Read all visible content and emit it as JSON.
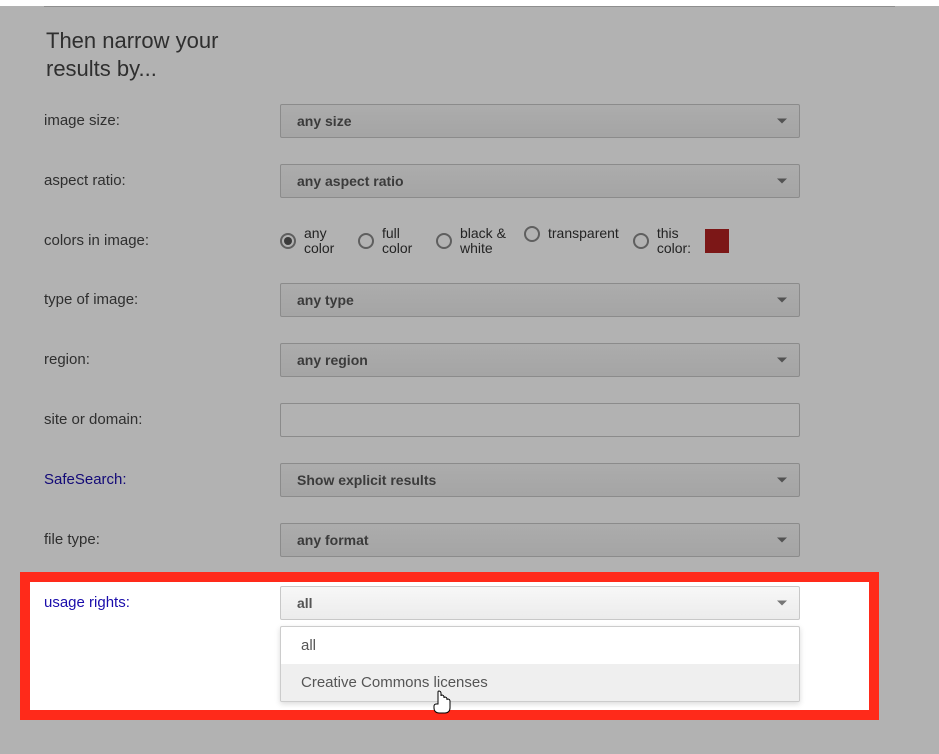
{
  "heading": "Then narrow your results by...",
  "rows": {
    "image_size": {
      "label": "image size:",
      "value": "any size"
    },
    "aspect_ratio": {
      "label": "aspect ratio:",
      "value": "any aspect ratio"
    },
    "colors": {
      "label": "colors in image:",
      "options": {
        "any": "any color",
        "full": "full color",
        "bw": "black & white",
        "transparent": "transparent",
        "this": "this color:"
      },
      "selected": "any",
      "swatch_color": "#b22222"
    },
    "type_of_image": {
      "label": "type of image:",
      "value": "any type"
    },
    "region": {
      "label": "region:",
      "value": "any region"
    },
    "site_or_domain": {
      "label": "site or domain:",
      "value": ""
    },
    "safesearch": {
      "label": "SafeSearch:",
      "value": "Show explicit results"
    },
    "file_type": {
      "label": "file type:",
      "value": "any format"
    },
    "usage_rights": {
      "label": "usage rights:",
      "value": "all",
      "menu": {
        "all": "all",
        "cc": "Creative Commons licenses"
      }
    }
  }
}
